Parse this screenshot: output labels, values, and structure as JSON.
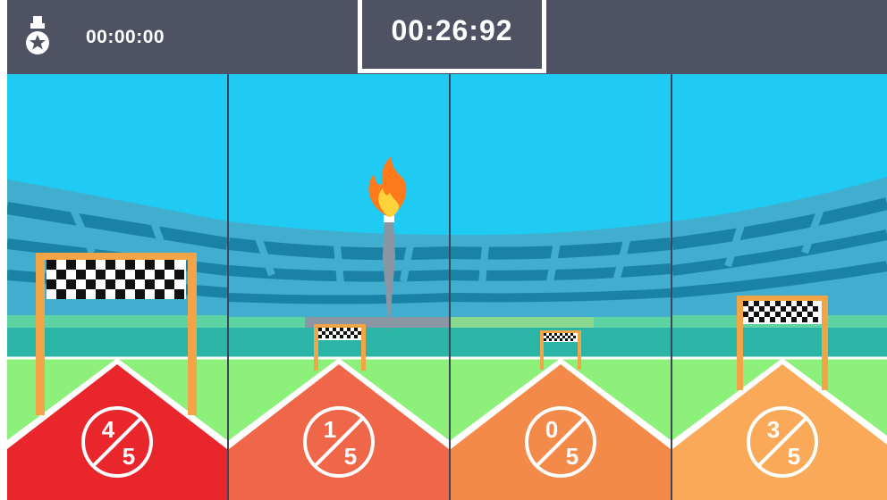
{
  "header": {
    "best_time": "00:00:00",
    "timer": "00:26:92",
    "medal_icon": "medal-star-icon"
  },
  "lanes": [
    {
      "numerator": "4",
      "denominator": "5",
      "color": "#e8262c"
    },
    {
      "numerator": "1",
      "denominator": "5",
      "color": "#ef6748"
    },
    {
      "numerator": "0",
      "denominator": "5",
      "color": "#f38a4a"
    },
    {
      "numerator": "3",
      "denominator": "5",
      "color": "#f9a957"
    }
  ],
  "colors": {
    "sky": "#1fcaf3",
    "stands_light": "#42aecf",
    "stands_dark": "#1a83a5",
    "grass": "#8cf07a",
    "topbar": "#4e5263",
    "gate": "#f3a447"
  },
  "torch_icon": "torch-flame-icon"
}
